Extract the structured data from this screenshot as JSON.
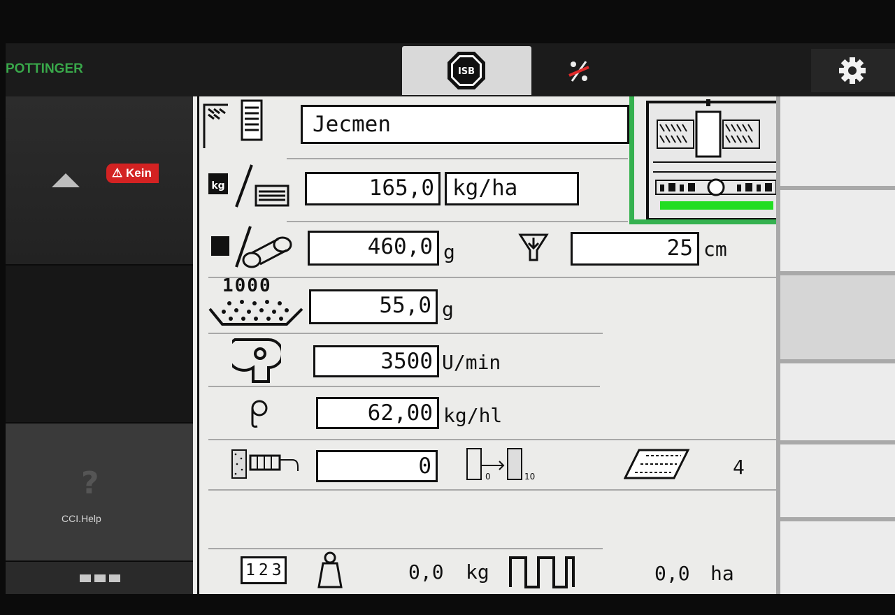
{
  "brand": "POTTINGER",
  "top_bar": {
    "tabs": [
      {
        "icon": "isb-stop-icon",
        "label": "ISB"
      },
      {
        "icon": "percent-off-icon"
      }
    ],
    "settings_icon": "gear-icon"
  },
  "left_sidebar": {
    "alert_badge": "Kein",
    "help_label": "CCI.Help",
    "help_glyph": "?"
  },
  "main": {
    "crop_name": "Jecmen",
    "application_rate": {
      "value": "165,0",
      "unit": "kg/ha"
    },
    "calibration_weight": {
      "value": "460,0",
      "unit": "g"
    },
    "sowing_depth": {
      "value": "25",
      "unit": "cm"
    },
    "thousand_grain": {
      "label": "1000",
      "value": "55,0",
      "unit": "g"
    },
    "fan_speed": {
      "value": "3500",
      "unit": "U/min"
    },
    "density": {
      "value": "62,00",
      "unit": "kg/hl"
    },
    "sensor_value": {
      "value": "0"
    },
    "tramline_count": "4",
    "footer": {
      "counter_icon": "123",
      "weight": "0,0",
      "weight_unit": "kg",
      "area": "0,0",
      "area_unit": "ha"
    }
  },
  "colors": {
    "highlight": "#35b14f",
    "alert": "#d32222",
    "brand": "#39a84a"
  }
}
